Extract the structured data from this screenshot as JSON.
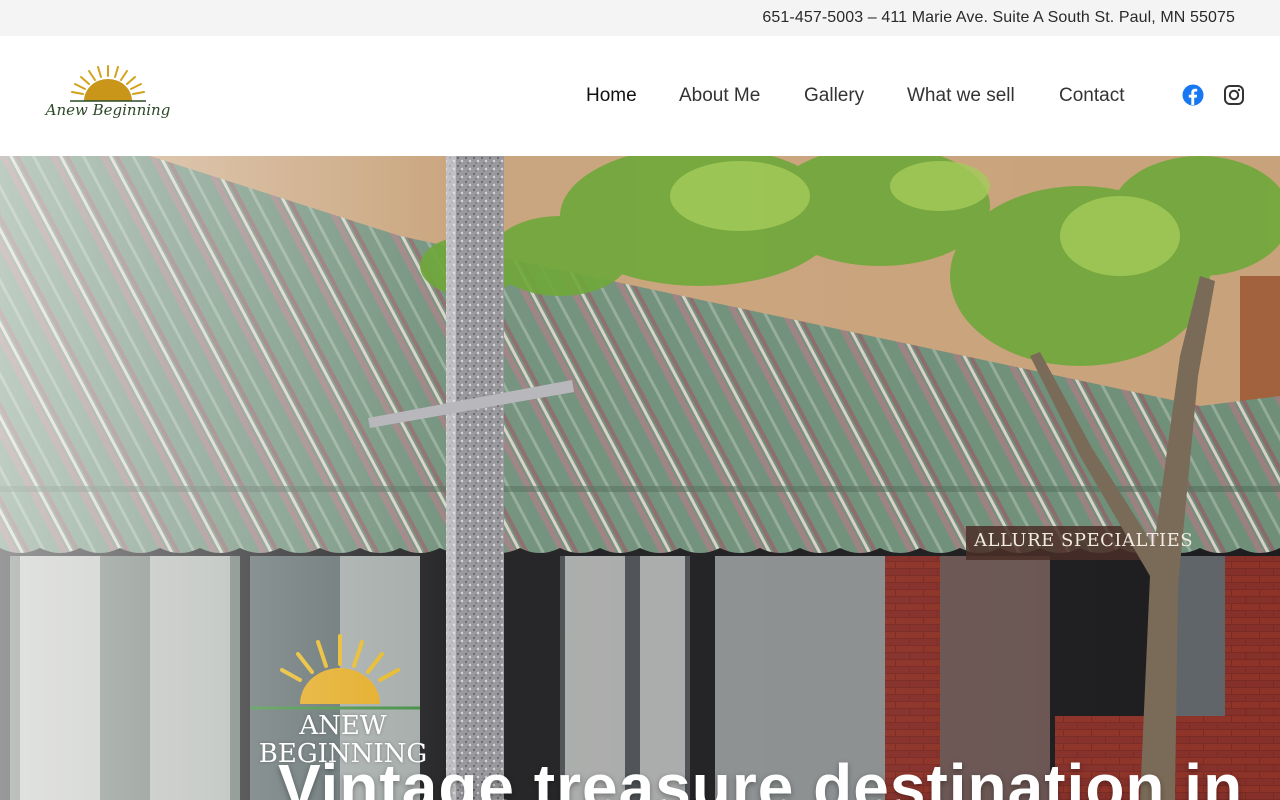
{
  "topbar": {
    "contact": "651-457-5003 – 411 Marie Ave. Suite A South St. Paul, MN 55075"
  },
  "brand": {
    "name": "Anew Beginning",
    "sun_color": "#d2a21b",
    "text_color": "#2d4a28"
  },
  "nav": {
    "items": [
      {
        "label": "Home",
        "active": true
      },
      {
        "label": "About Me",
        "active": false
      },
      {
        "label": "Gallery",
        "active": false
      },
      {
        "label": "What we sell",
        "active": false
      },
      {
        "label": "Contact",
        "active": false
      }
    ],
    "social": [
      {
        "icon": "facebook-icon",
        "color": "#1877f2"
      },
      {
        "icon": "instagram-icon",
        "color": "#333333"
      }
    ]
  },
  "hero": {
    "title": "Vintage treasure destination in",
    "store_sign": "ALLURE SPECIALTIES",
    "window_logo": "ANEW BEGINNING",
    "awning_green": "#6f8f79",
    "awning_stripe": "#8a6a6a"
  }
}
